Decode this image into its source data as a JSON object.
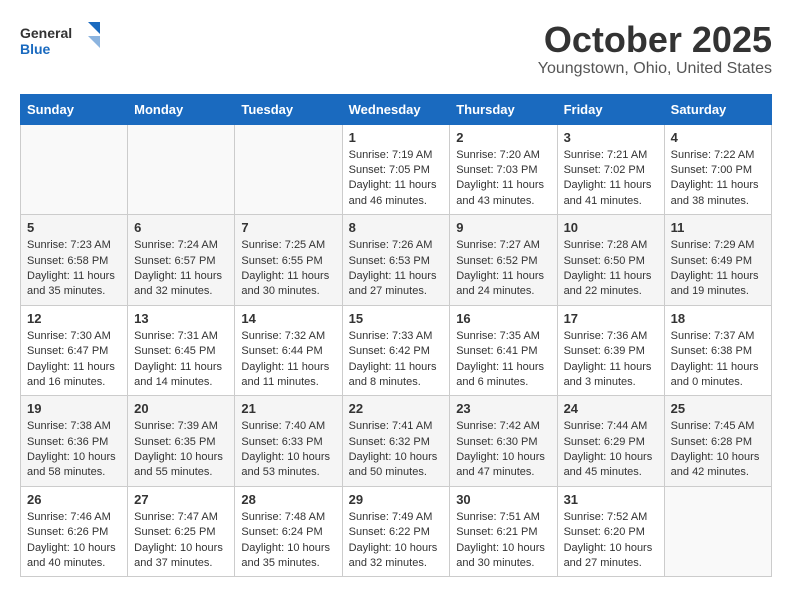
{
  "header": {
    "logo_general": "General",
    "logo_blue": "Blue",
    "month": "October 2025",
    "location": "Youngstown, Ohio, United States"
  },
  "days_of_week": [
    "Sunday",
    "Monday",
    "Tuesday",
    "Wednesday",
    "Thursday",
    "Friday",
    "Saturday"
  ],
  "weeks": [
    [
      {
        "day": "",
        "info": ""
      },
      {
        "day": "",
        "info": ""
      },
      {
        "day": "",
        "info": ""
      },
      {
        "day": "1",
        "info": "Sunrise: 7:19 AM\nSunset: 7:05 PM\nDaylight: 11 hours and 46 minutes."
      },
      {
        "day": "2",
        "info": "Sunrise: 7:20 AM\nSunset: 7:03 PM\nDaylight: 11 hours and 43 minutes."
      },
      {
        "day": "3",
        "info": "Sunrise: 7:21 AM\nSunset: 7:02 PM\nDaylight: 11 hours and 41 minutes."
      },
      {
        "day": "4",
        "info": "Sunrise: 7:22 AM\nSunset: 7:00 PM\nDaylight: 11 hours and 38 minutes."
      }
    ],
    [
      {
        "day": "5",
        "info": "Sunrise: 7:23 AM\nSunset: 6:58 PM\nDaylight: 11 hours and 35 minutes."
      },
      {
        "day": "6",
        "info": "Sunrise: 7:24 AM\nSunset: 6:57 PM\nDaylight: 11 hours and 32 minutes."
      },
      {
        "day": "7",
        "info": "Sunrise: 7:25 AM\nSunset: 6:55 PM\nDaylight: 11 hours and 30 minutes."
      },
      {
        "day": "8",
        "info": "Sunrise: 7:26 AM\nSunset: 6:53 PM\nDaylight: 11 hours and 27 minutes."
      },
      {
        "day": "9",
        "info": "Sunrise: 7:27 AM\nSunset: 6:52 PM\nDaylight: 11 hours and 24 minutes."
      },
      {
        "day": "10",
        "info": "Sunrise: 7:28 AM\nSunset: 6:50 PM\nDaylight: 11 hours and 22 minutes."
      },
      {
        "day": "11",
        "info": "Sunrise: 7:29 AM\nSunset: 6:49 PM\nDaylight: 11 hours and 19 minutes."
      }
    ],
    [
      {
        "day": "12",
        "info": "Sunrise: 7:30 AM\nSunset: 6:47 PM\nDaylight: 11 hours and 16 minutes."
      },
      {
        "day": "13",
        "info": "Sunrise: 7:31 AM\nSunset: 6:45 PM\nDaylight: 11 hours and 14 minutes."
      },
      {
        "day": "14",
        "info": "Sunrise: 7:32 AM\nSunset: 6:44 PM\nDaylight: 11 hours and 11 minutes."
      },
      {
        "day": "15",
        "info": "Sunrise: 7:33 AM\nSunset: 6:42 PM\nDaylight: 11 hours and 8 minutes."
      },
      {
        "day": "16",
        "info": "Sunrise: 7:35 AM\nSunset: 6:41 PM\nDaylight: 11 hours and 6 minutes."
      },
      {
        "day": "17",
        "info": "Sunrise: 7:36 AM\nSunset: 6:39 PM\nDaylight: 11 hours and 3 minutes."
      },
      {
        "day": "18",
        "info": "Sunrise: 7:37 AM\nSunset: 6:38 PM\nDaylight: 11 hours and 0 minutes."
      }
    ],
    [
      {
        "day": "19",
        "info": "Sunrise: 7:38 AM\nSunset: 6:36 PM\nDaylight: 10 hours and 58 minutes."
      },
      {
        "day": "20",
        "info": "Sunrise: 7:39 AM\nSunset: 6:35 PM\nDaylight: 10 hours and 55 minutes."
      },
      {
        "day": "21",
        "info": "Sunrise: 7:40 AM\nSunset: 6:33 PM\nDaylight: 10 hours and 53 minutes."
      },
      {
        "day": "22",
        "info": "Sunrise: 7:41 AM\nSunset: 6:32 PM\nDaylight: 10 hours and 50 minutes."
      },
      {
        "day": "23",
        "info": "Sunrise: 7:42 AM\nSunset: 6:30 PM\nDaylight: 10 hours and 47 minutes."
      },
      {
        "day": "24",
        "info": "Sunrise: 7:44 AM\nSunset: 6:29 PM\nDaylight: 10 hours and 45 minutes."
      },
      {
        "day": "25",
        "info": "Sunrise: 7:45 AM\nSunset: 6:28 PM\nDaylight: 10 hours and 42 minutes."
      }
    ],
    [
      {
        "day": "26",
        "info": "Sunrise: 7:46 AM\nSunset: 6:26 PM\nDaylight: 10 hours and 40 minutes."
      },
      {
        "day": "27",
        "info": "Sunrise: 7:47 AM\nSunset: 6:25 PM\nDaylight: 10 hours and 37 minutes."
      },
      {
        "day": "28",
        "info": "Sunrise: 7:48 AM\nSunset: 6:24 PM\nDaylight: 10 hours and 35 minutes."
      },
      {
        "day": "29",
        "info": "Sunrise: 7:49 AM\nSunset: 6:22 PM\nDaylight: 10 hours and 32 minutes."
      },
      {
        "day": "30",
        "info": "Sunrise: 7:51 AM\nSunset: 6:21 PM\nDaylight: 10 hours and 30 minutes."
      },
      {
        "day": "31",
        "info": "Sunrise: 7:52 AM\nSunset: 6:20 PM\nDaylight: 10 hours and 27 minutes."
      },
      {
        "day": "",
        "info": ""
      }
    ]
  ]
}
